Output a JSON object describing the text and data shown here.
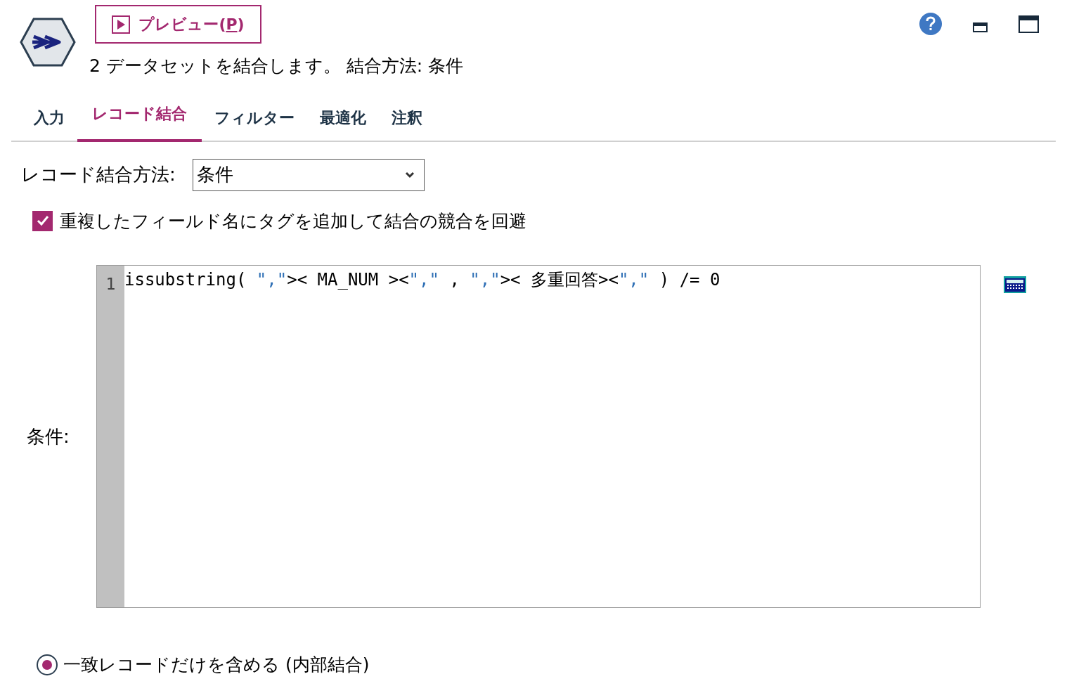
{
  "preview_button": {
    "label": "プレビュー(",
    "mnemonic": "P",
    "suffix": ")"
  },
  "description": "2 データセットを結合します。 結合方法: 条件",
  "tabs": [
    {
      "label": "入力",
      "selected": false
    },
    {
      "label": "レコード結合",
      "selected": true
    },
    {
      "label": "フィルター",
      "selected": false
    },
    {
      "label": "最適化",
      "selected": false
    },
    {
      "label": "注釈",
      "selected": false
    }
  ],
  "merge_method": {
    "label": "レコード結合方法:",
    "value": "条件"
  },
  "tag_duplicates": {
    "label": "重複したフィールド名にタグを追加して結合の競合を回避",
    "checked": true
  },
  "condition": {
    "label": "条件:",
    "line_number": "1",
    "tokens": [
      {
        "kind": "plain",
        "text": "issubstring( "
      },
      {
        "kind": "string",
        "text": "\",\""
      },
      {
        "kind": "plain",
        "text": ">< MA_NUM ><"
      },
      {
        "kind": "string",
        "text": "\",\""
      },
      {
        "kind": "plain",
        "text": " , "
      },
      {
        "kind": "string",
        "text": "\",\""
      },
      {
        "kind": "plain",
        "text": ">< 多重回答><"
      },
      {
        "kind": "string",
        "text": "\",\""
      },
      {
        "kind": "plain",
        "text": " ) /= 0"
      }
    ]
  },
  "join_type": {
    "label": "一致レコードだけを含める (内部結合)",
    "selected": true
  }
}
